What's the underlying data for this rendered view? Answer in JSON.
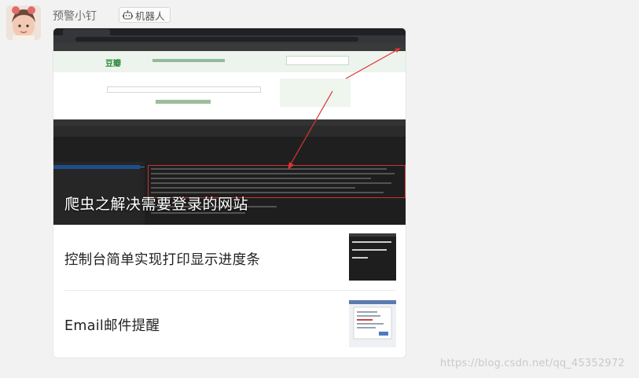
{
  "message": {
    "sender_name": "预警小钉",
    "bot_label": "机器人",
    "icons": {
      "avatar": "user-avatar-photo",
      "bot": "robot-icon"
    }
  },
  "card": {
    "hero": {
      "title": "爬虫之解决需要登录的网站",
      "image": "browser-devtools-screenshot"
    },
    "items": [
      {
        "title": "控制台简单实现打印显示进度条",
        "thumb": "terminal-screenshot"
      },
      {
        "title": "Email邮件提醒",
        "thumb": "dialog-screenshot"
      }
    ]
  },
  "watermark": "https://blog.csdn.net/qq_45352972",
  "colors": {
    "background": "#f2f2f2",
    "card": "#ffffff",
    "title": "#222222",
    "hero_title": "#ffffff"
  }
}
